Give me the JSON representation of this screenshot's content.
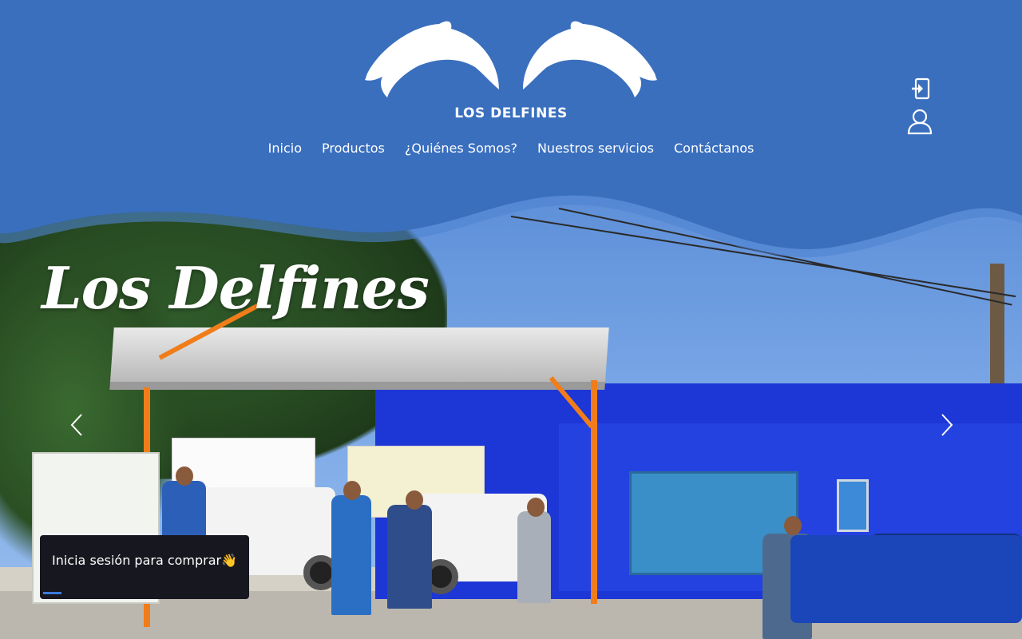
{
  "brand": {
    "name": "LOS DELFINES",
    "colors": {
      "header": "#3a6fbe",
      "text": "#ffffff",
      "toast_bg": "#17181f",
      "toast_progress": "#3b7bdc"
    }
  },
  "nav": {
    "items": [
      {
        "label": "Inicio"
      },
      {
        "label": "Productos"
      },
      {
        "label": "¿Quiénes Somos?"
      },
      {
        "label": "Nuestros servicios"
      },
      {
        "label": "Contáctanos"
      }
    ]
  },
  "header_icons": {
    "login": "login-icon",
    "account": "user-icon"
  },
  "hero": {
    "title": "Los Delfines",
    "prev_icon": "chevron-left-icon",
    "next_icon": "chevron-right-icon"
  },
  "toast": {
    "message": "Inicia sesión para comprar",
    "emoji": "👋",
    "progress": 0.09
  }
}
